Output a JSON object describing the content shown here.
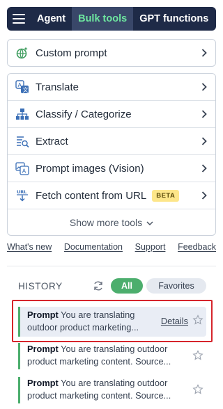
{
  "topbar": {
    "tabs": [
      {
        "label": "Agent",
        "active": false
      },
      {
        "label": "Bulk tools",
        "active": true
      },
      {
        "label": "GPT functions",
        "active": false
      }
    ]
  },
  "custom_prompt": {
    "label": "Custom prompt",
    "icon": "globe-sparkle-icon"
  },
  "tools": [
    {
      "label": "Translate",
      "icon": "translate-icon"
    },
    {
      "label": "Classify / Categorize",
      "icon": "hierarchy-icon"
    },
    {
      "label": "Extract",
      "icon": "extract-icon"
    },
    {
      "label": "Prompt images (Vision)",
      "icon": "image-prompt-icon"
    },
    {
      "label": "Fetch content from URL",
      "icon": "url-download-icon",
      "badge": "BETA"
    }
  ],
  "show_more": "Show more tools",
  "links": [
    "What's new",
    "Documentation",
    "Support",
    "Feedback"
  ],
  "history": {
    "title": "HISTORY",
    "filter_all": "All",
    "filter_favorites": "Favorites",
    "items": [
      {
        "prefix": "Prompt",
        "text": "You are translating outdoor product marketing...",
        "details": "Details",
        "selected": true
      },
      {
        "prefix": "Prompt",
        "text": "You are translating outdoor product marketing content. Source...",
        "selected": false
      },
      {
        "prefix": "Prompt",
        "text": "You are translating outdoor product marketing content. Source...",
        "selected": false
      }
    ]
  },
  "colors": {
    "navy": "#1e2a47",
    "active_tab_text": "#6ee7a0",
    "accent_green": "#4cae6d",
    "highlight_red": "#d6242b"
  }
}
